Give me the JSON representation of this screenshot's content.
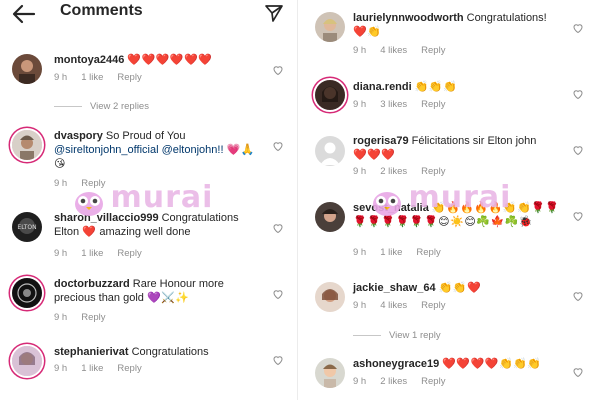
{
  "header": {
    "title": "Comments"
  },
  "watermark": {
    "text": "murai"
  },
  "left_comments": [
    {
      "username": "montoya2446",
      "text": "",
      "emoji": "❤️❤️❤️❤️❤️❤️",
      "time": "9 h",
      "likes": "1 like",
      "reply": "Reply"
    },
    {
      "username": "dvaspory",
      "text": "So Proud of You",
      "mentions": "@sireltonjohn_official @eltonjohn!!",
      "emoji": "💗🙏😘",
      "time": "9 h",
      "likes": "",
      "reply": "Reply"
    },
    {
      "username": "sharon_villaccio999",
      "text": "Congratulations Elton",
      "emoji": "❤️",
      "text2": "amazing well done",
      "time": "9 h",
      "likes": "1 like",
      "reply": "Reply"
    },
    {
      "username": "doctorbuzzard",
      "text": "Rare Honour more precious than gold",
      "emoji": "💜⚔️✨",
      "time": "9 h",
      "likes": "",
      "reply": "Reply"
    },
    {
      "username": "stephanierivat",
      "text": "Congratulations",
      "emoji": "",
      "time": "9 h",
      "likes": "1 like",
      "reply": "Reply"
    }
  ],
  "left_view_replies": "View 2 replies",
  "right_comments": [
    {
      "username": "laurielynnwoodworth",
      "text": "Congratulations!",
      "emoji": "❤️👏",
      "time": "9 h",
      "likes": "4 likes",
      "reply": "Reply"
    },
    {
      "username": "diana.rendi",
      "text": "",
      "emoji": "👏👏👏",
      "time": "9 h",
      "likes": "3 likes",
      "reply": "Reply"
    },
    {
      "username": "rogerisa79",
      "text": "Félicitations  sir Elton john",
      "emoji": "❤️❤️❤️",
      "time": "9 h",
      "likes": "2 likes",
      "reply": "Reply"
    },
    {
      "username": "sevost_natalia",
      "text": "",
      "emoji": "👏🔥🔥🔥🔥👏👏🌹🌹🌹🌹🌹🌹🌹🌹😊☀️😊☘️🍁☘️🐞",
      "time": "9 h",
      "likes": "1 like",
      "reply": "Reply"
    },
    {
      "username": "jackie_shaw_64",
      "text": "",
      "emoji": "👏👏❤️",
      "time": "9 h",
      "likes": "4 likes",
      "reply": "Reply"
    },
    {
      "username": "ashoneygrace19",
      "text": "",
      "emoji": "❤️❤️❤️❤️👏👏👏",
      "time": "9 h",
      "likes": "2 likes",
      "reply": "Reply"
    }
  ],
  "right_view_replies": "View 1 reply",
  "colors": {
    "accent": "#ed4956",
    "muted": "#8e8e8e",
    "ring": "#d62976",
    "watermark": "#e9b7e6"
  }
}
